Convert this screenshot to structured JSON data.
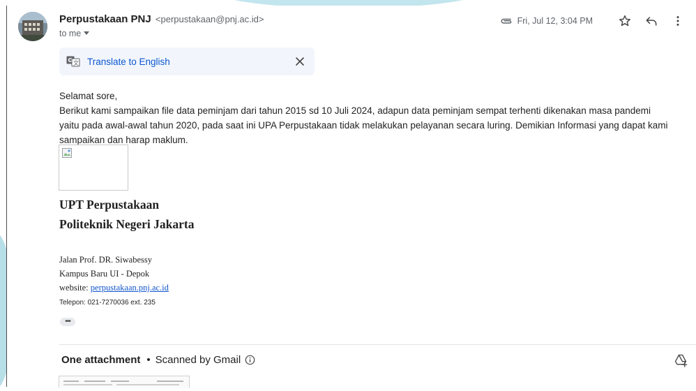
{
  "email": {
    "sender_name": "Perpustakaan PNJ",
    "sender_email": "<perpustakaan@pnj.ac.id>",
    "to": "to me",
    "date": "Fri, Jul 12, 3:04 PM"
  },
  "translate": {
    "label": "Translate to English"
  },
  "body": {
    "greeting": "Selamat sore,",
    "paragraph": "Berikut kami sampaikan file data peminjam dari tahun 2015 sd 10 Juli 2024, adapun data peminjam sempat terhenti dikenakan masa pandemi yaitu pada awal-awal tahun 2020, pada saat ini UPA Perpustakaan tidak melakukan pelayanan secara luring. Demikian Informasi yang dapat kami sampaikan dan  harap maklum."
  },
  "signature": {
    "org_line1": "UPT Perpustakaan",
    "org_line2": "Politeknik Negeri Jakarta",
    "address1": "Jalan Prof. DR. Siwabessy",
    "address2": "Kampus Baru UI - Depok",
    "website_label": "website: ",
    "website_link": "perpustakaan.pnj.ac.id",
    "phone": "Telepon: 021-7270036 ext. 235"
  },
  "more_dots": "•••",
  "attachments": {
    "count_label": "One attachment",
    "separator": "•",
    "scan_label": "Scanned by Gmail"
  },
  "icons": {
    "attachment": "paperclip-icon",
    "star": "star-icon",
    "reply": "reply-icon",
    "more": "more-vert-icon",
    "translate": "translate-icon",
    "close": "close-icon",
    "info": "info-icon",
    "drive": "add-to-drive-icon"
  },
  "colors": {
    "link_blue": "#0b57d0",
    "signature_link": "#1155cc",
    "translate_bar_bg": "#f2f6fc",
    "muted_text": "#5f6368"
  }
}
